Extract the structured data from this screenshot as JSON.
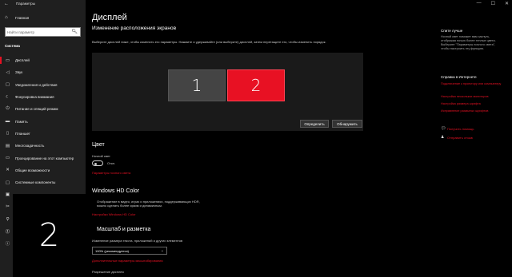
{
  "window": {
    "title": "Параметры",
    "back": "←",
    "controls": [
      "—",
      "☐",
      "✕"
    ]
  },
  "sidebar": {
    "home": {
      "icon": "home-icon",
      "glyph": "⌂",
      "label": "Главная"
    },
    "search": {
      "placeholder": "Найти параметр",
      "icon": "🔍︎"
    },
    "section": "Система",
    "items": [
      {
        "name": "display",
        "label": "Дисплей",
        "glyph": "▭"
      },
      {
        "name": "sound",
        "label": "Звук",
        "glyph": "◁"
      },
      {
        "name": "notifications",
        "label": "Уведомления и действия",
        "glyph": "▢"
      },
      {
        "name": "focus",
        "label": "Фокусировка внимания",
        "glyph": "☾"
      },
      {
        "name": "power",
        "label": "Питание и спящий режим",
        "glyph": "⏻"
      },
      {
        "name": "storage",
        "label": "Память",
        "glyph": "▬"
      },
      {
        "name": "tablet",
        "label": "Планшет",
        "glyph": "▯"
      },
      {
        "name": "multitasking",
        "label": "Многозадачность",
        "glyph": "▤"
      },
      {
        "name": "projecting",
        "label": "Проецирование на этот компьютер",
        "glyph": "▭"
      },
      {
        "name": "shared",
        "label": "Общие возможности",
        "glyph": "✕"
      },
      {
        "name": "clipboard",
        "label": "Системные компоненты",
        "glyph": "▢"
      }
    ],
    "partial_icons": [
      "▣",
      "✂",
      "⚲",
      "⓵",
      "ⓘ"
    ]
  },
  "identify_overlay": {
    "number": "2"
  },
  "main": {
    "title": "Дисплей",
    "subtitle": "Изменение расположения экранов",
    "instruction": "Выберите дисплей ниже, чтобы изменить его параметры. Нажмите и удерживайте (или выберите) дисплей, затем перетащите его, чтобы изменить порядок.",
    "monitors": [
      {
        "number": "1",
        "selected": false
      },
      {
        "number": "2",
        "selected": true
      }
    ],
    "identify_button": "Определить",
    "detect_button": "Обнаружить",
    "color_heading": "Цвет",
    "night_light_label": "Ночной свет",
    "night_light_state": "Откл.",
    "night_light_link": "Параметры ночного света",
    "hdr_heading": "Windows HD Color",
    "hdr_description": "Отображение в видео, играх и приложениях, поддерживающих HDR, можно сделать более ярким и динамичным.",
    "hdr_link": "Настройки Windows HD Color",
    "scale_heading": "Масштаб и разметка",
    "scale_label": "Изменение размера текста, приложений и других элементов",
    "scale_value": "100% (рекомендуется)",
    "scale_chevron": "⌄",
    "advanced_scale_link": "Дополнительные параметры масштабирования",
    "resolution_label": "Разрешение дисплея"
  },
  "right_panel": {
    "sleep_heading": "Спите лучше",
    "sleep_text": "Ночной свет поможет вам заснуть, отображая ночью более теплые цвета. Выберите \"Параметры ночного света\", чтобы настроить эту функцию.",
    "web_heading": "Справка в Интернете",
    "links": [
      "Подключение к проектору или компьютеру",
      "Настройка нескольких мониторов",
      "Настройка размера шрифта",
      "Исправление размытых шрифтов"
    ],
    "help_label": "Получить помощь",
    "help_icon": "help-icon",
    "feedback_label": "Отправить отзыв",
    "feedback_icon": "feedback-icon"
  },
  "colors": {
    "accent": "#e81123",
    "sidebar_bg": "#1f1f1f",
    "main_bg": "#000000"
  }
}
